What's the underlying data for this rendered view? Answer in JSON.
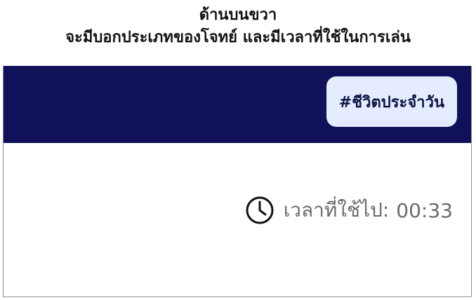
{
  "caption": {
    "line1": "ด้านบนขวา",
    "line2": "จะมีบอกประเภทของโจทย์ และมีเวลาที่ใช้ในการเล่น"
  },
  "header": {
    "category_tag": "#ชีวิตประจำวัน"
  },
  "timer": {
    "label": "เวลาที่ใช้ไป:",
    "value": "00:33",
    "icon": "clock-icon"
  },
  "colors": {
    "header_bg": "#111159",
    "chip_bg": "#e6ecff",
    "chip_text": "#0b1442",
    "timer_text": "#6b6b6b"
  }
}
